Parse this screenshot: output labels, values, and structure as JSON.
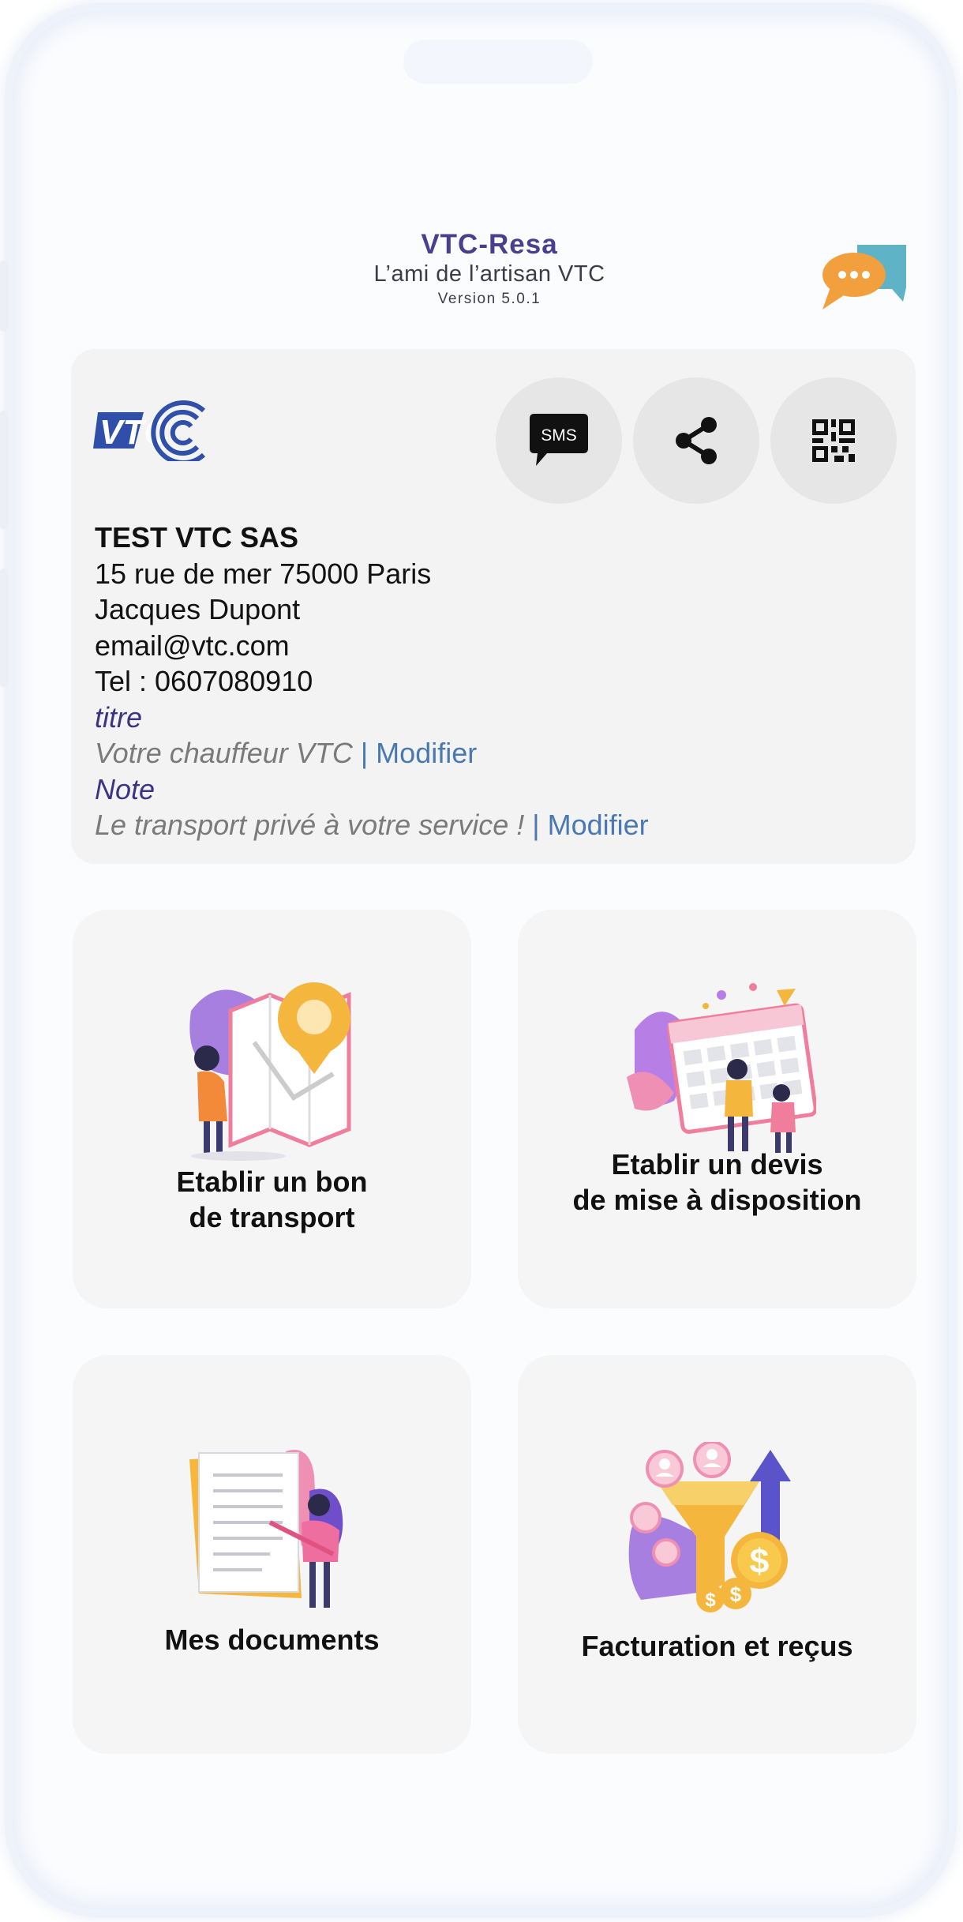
{
  "header": {
    "title": "VTC-Resa",
    "subtitle": "L’ami de l’artisan VTC",
    "version": "Version 5.0.1",
    "chat_icon": "chat-bubbles-icon"
  },
  "profile": {
    "logo_text": "VTC",
    "actions": [
      {
        "name": "sms",
        "icon": "sms-icon",
        "label": "SMS"
      },
      {
        "name": "share",
        "icon": "share-icon"
      },
      {
        "name": "qr",
        "icon": "qr-code-icon"
      }
    ],
    "company": "TEST VTC SAS",
    "address": "15 rue de mer 75000 Paris",
    "contact_name": "Jacques Dupont",
    "email": "email@vtc.com",
    "phone": "Tel : 0607080910",
    "titre_label": "titre",
    "titre_value": "Votre chauffeur VTC",
    "note_label": "Note",
    "note_value": "Le transport privé à votre service ! ",
    "modify_link": "| Modifier"
  },
  "tiles": [
    {
      "label": "Etablir un bon\nde transport",
      "illustration": "map-location-illustration"
    },
    {
      "label": "Etablir un devis\nde mise à disposition",
      "illustration": "calendar-planning-illustration"
    },
    {
      "label": "Mes documents",
      "illustration": "documents-illustration"
    },
    {
      "label": "Facturation et reçus",
      "illustration": "billing-funnel-illustration"
    }
  ],
  "colors": {
    "brand_purple": "#4a3f8f",
    "link_blue": "#4a79b0",
    "card_bg": "#f3f3f4",
    "logo_blue": "#2f4fa8"
  }
}
